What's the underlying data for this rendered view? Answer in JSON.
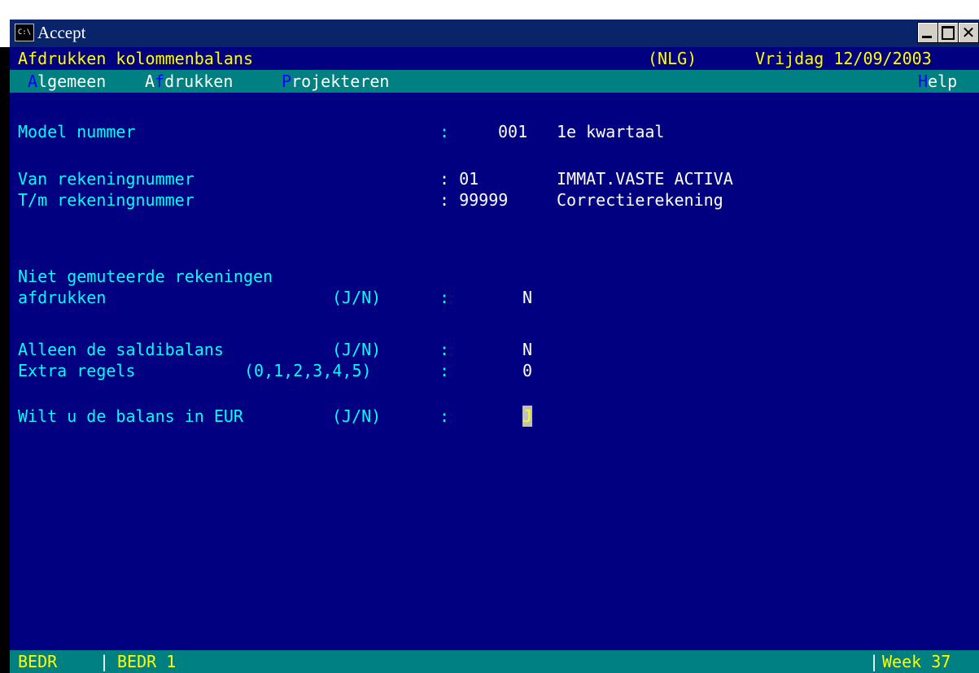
{
  "window": {
    "title": "Accept",
    "icon_text": "C:\\",
    "buttons": {
      "minimize": "minimize-icon",
      "maximize": "maximize-icon",
      "close": "close-icon"
    }
  },
  "header": {
    "left": "Afdrukken kolommenbalans",
    "currency": "(NLG)",
    "date": "Vrijdag 12/09/2003"
  },
  "menu": {
    "items": [
      {
        "hot": "A",
        "rest": "lgemeen"
      },
      {
        "pre": "A",
        "hot": "f",
        "rest": "drukken"
      },
      {
        "hot": "P",
        "rest": "rojekteren"
      }
    ],
    "help": {
      "hot": "H",
      "rest": "elp"
    }
  },
  "form": {
    "model_label": "Model nummer",
    "model_colon": ":",
    "model_value": "001",
    "model_desc": "1e kwartaal",
    "van_label": "Van rekeningnummer",
    "van_colon": ": 01",
    "van_desc": "IMMAT.VASTE ACTIVA",
    "tm_label": "T/m rekeningnummer",
    "tm_colon": ": 99999",
    "tm_desc": "Correctierekening",
    "niet_label1": "Niet gemuteerde rekeningen",
    "niet_label2": "afdrukken",
    "niet_opts": "(J/N)",
    "niet_colon": ":",
    "niet_value": "N",
    "alleen_label": "Alleen de saldibalans",
    "alleen_opts": "(J/N)",
    "alleen_colon": ":",
    "alleen_value": "N",
    "extra_label": "Extra regels",
    "extra_opts": "(0,1,2,3,4,5)",
    "extra_colon": ":",
    "extra_value": "0",
    "eur_label": "Wilt u de balans in EUR",
    "eur_opts": "(J/N)",
    "eur_colon": ":",
    "eur_value": "J"
  },
  "status": {
    "left": "BEDR",
    "mid": "BEDR 1",
    "right": "Week 37"
  },
  "colors": {
    "background": "#000080",
    "label": "#00ffff",
    "value": "#ffffff",
    "header_text": "#ffff00",
    "menu_bg": "#008080",
    "menu_hotkey": "#0000ff"
  }
}
